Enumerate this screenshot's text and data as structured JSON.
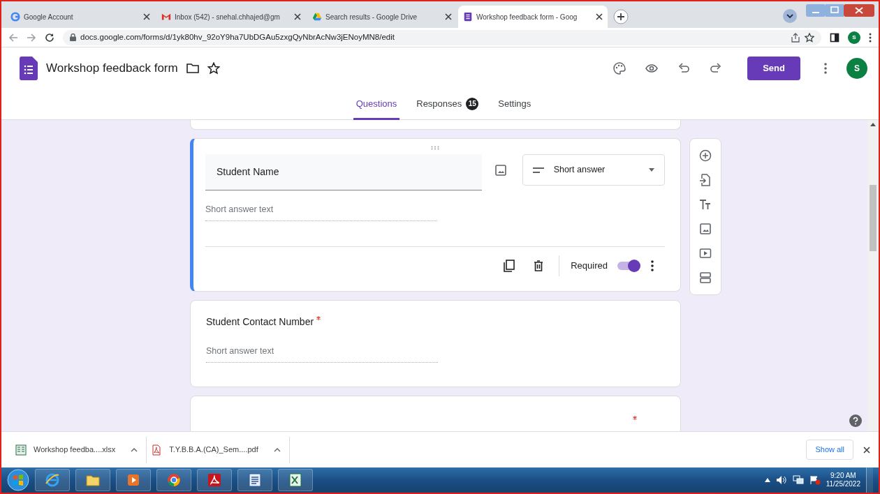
{
  "browser": {
    "tabs": [
      {
        "title": "Google Account",
        "kind": "google",
        "selected": false
      },
      {
        "title": "Inbox (542) - snehal.chhajed@gm",
        "kind": "gmail",
        "selected": false
      },
      {
        "title": "Search results - Google Drive",
        "kind": "drive",
        "selected": false
      },
      {
        "title": "Workshop feedback form - Goog",
        "kind": "forms",
        "selected": true
      }
    ],
    "url": "docs.google.com/forms/d/1yk80hv_92oY9ha7UbDGAu5zxgQyNbrAcNw3jENoyMN8/edit",
    "profile_initial": "S"
  },
  "form_header": {
    "title": "Workshop feedback form",
    "send": "Send",
    "avatar": "S"
  },
  "tabs": [
    {
      "label": "Questions",
      "selected": true
    },
    {
      "label": "Responses",
      "badge": "15",
      "selected": false
    },
    {
      "label": "Settings",
      "selected": false
    }
  ],
  "questions": [
    {
      "title": "Student Name",
      "placeholder": "Short answer text",
      "active": true,
      "type": "Short answer",
      "required_label": "Required",
      "required": true
    },
    {
      "title": "Student Contact Number",
      "placeholder": "Short answer text",
      "active": false,
      "required": true
    },
    {
      "active": false,
      "required": true
    }
  ],
  "downloads": [
    {
      "name": "Workshop feedba....xlsx",
      "kind": "excel"
    },
    {
      "name": "T.Y.B.B.A.(CA)_Sem....pdf",
      "kind": "pdf"
    }
  ],
  "show_all": "Show all",
  "taskbar": {
    "apps": [
      {
        "kind": "ie"
      },
      {
        "kind": "explorer"
      },
      {
        "kind": "media"
      },
      {
        "kind": "chrome"
      },
      {
        "kind": "acrobat"
      },
      {
        "kind": "word"
      },
      {
        "kind": "excel"
      }
    ],
    "time": "9:20 AM",
    "date": "11/25/2022"
  }
}
